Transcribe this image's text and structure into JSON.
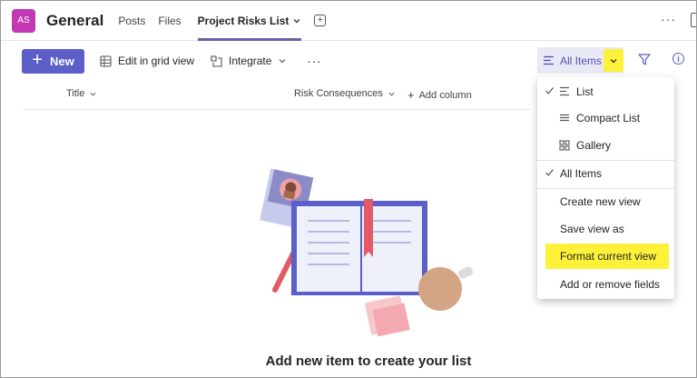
{
  "header": {
    "avatar_initials": "AS",
    "channel_name": "General",
    "tabs": [
      {
        "label": "Posts"
      },
      {
        "label": "Files"
      },
      {
        "label": "Project Risks List"
      }
    ],
    "more_label": "···"
  },
  "toolbar": {
    "new_label": "New",
    "grid_label": "Edit in grid view",
    "integrate_label": "Integrate",
    "more_label": "···",
    "view_label": "All Items"
  },
  "columns": {
    "title": "Title",
    "risk": "Risk Consequences",
    "add": "Add column"
  },
  "empty_state": {
    "message": "Add new item to create your list"
  },
  "view_menu": {
    "layouts": [
      {
        "label": "List",
        "checked": true,
        "icon": "list-icon"
      },
      {
        "label": "Compact List",
        "checked": false,
        "icon": "compact-list-icon"
      },
      {
        "label": "Gallery",
        "checked": false,
        "icon": "gallery-icon"
      }
    ],
    "views": [
      {
        "label": "All Items",
        "checked": true
      }
    ],
    "actions": [
      {
        "label": "Create new view"
      },
      {
        "label": "Save view as"
      },
      {
        "label": "Format current view",
        "highlighted": true
      },
      {
        "label": "Add or remove fields"
      }
    ]
  },
  "colors": {
    "accent": "#5b5fc7",
    "avatar": "#c239b3",
    "highlight": "#fdf13a"
  }
}
